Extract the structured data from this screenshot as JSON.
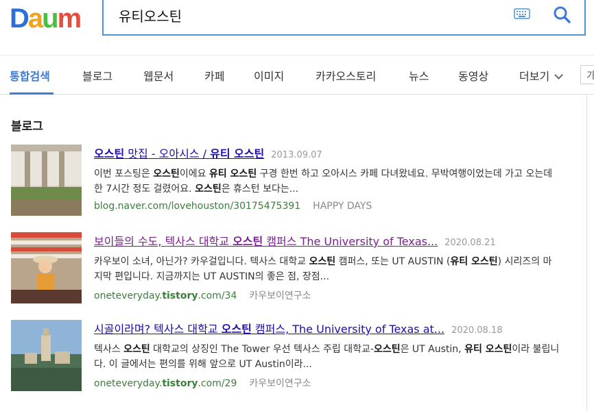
{
  "brand": {
    "logo_text": "Daum"
  },
  "search": {
    "query": "유티오스틴"
  },
  "tabs": [
    {
      "label": "통합검색",
      "active": true
    },
    {
      "label": "블로그"
    },
    {
      "label": "웹문서"
    },
    {
      "label": "카페"
    },
    {
      "label": "이미지"
    },
    {
      "label": "카카오스토리"
    },
    {
      "label": "뉴스"
    },
    {
      "label": "동영상"
    },
    {
      "label": "더보기"
    }
  ],
  "side_box_label": "가",
  "section": {
    "title": "블로그"
  },
  "results": [
    {
      "title_parts": [
        [
          "오스틴",
          true
        ],
        [
          " 맛집 - 오아시스 / ",
          false
        ],
        [
          "유티 오스틴",
          true
        ]
      ],
      "date": "2013.09.07",
      "desc_parts": [
        [
          "이번 포스팅은 ",
          false
        ],
        [
          "오스틴",
          true
        ],
        [
          "이에요 ",
          false
        ],
        [
          "유티 오스틴",
          true
        ],
        [
          " 구경 한번 하고 오아시스 카페 다녀왔네요. 무박여행이었는데 가고 오는데 한 7시간 정도 걸렸어요. ",
          false
        ],
        [
          "오스틴",
          true
        ],
        [
          "은 휴스턴 보다는...",
          false
        ]
      ],
      "url_parts": [
        [
          "blog.naver.com",
          false
        ],
        [
          "/lovehouston/30175475391",
          false
        ]
      ],
      "author": "HAPPY DAYS",
      "visited": false
    },
    {
      "title_parts": [
        [
          "보이들의 수도, 텍사스 대학교 ",
          false
        ],
        [
          "오스틴",
          true
        ],
        [
          " 캠퍼스 The University of Texas...",
          false
        ]
      ],
      "date": "2020.08.21",
      "desc_parts": [
        [
          "카우보이 소녀, 아닌가? 카우걸입니다. 텍사스 대학교 ",
          false
        ],
        [
          "오스틴",
          true
        ],
        [
          " 캠퍼스, 또는 UT AUSTIN (",
          false
        ],
        [
          "유티 오스틴",
          true
        ],
        [
          ") 시리즈의 마지막 편입니다. 지금까지는 UT AUSTIN의 좋은 점, 장점...",
          false
        ]
      ],
      "url_parts": [
        [
          "oneteveryday.",
          false
        ],
        [
          "tistory",
          true
        ],
        [
          ".com/34",
          false
        ]
      ],
      "author": "카우보이연구소",
      "visited": true
    },
    {
      "title_parts": [
        [
          "시골이라며? 텍사스 대학교 ",
          false
        ],
        [
          "오스틴",
          true
        ],
        [
          " 캠퍼스, The University of Texas at...",
          false
        ]
      ],
      "date": "2020.08.18",
      "desc_parts": [
        [
          "텍사스 ",
          false
        ],
        [
          "오스틴",
          true
        ],
        [
          " 대학교의 상징인 The Tower 우선 텍사스 주립 대학교-",
          false
        ],
        [
          "오스틴",
          true
        ],
        [
          "은 UT Austin, ",
          false
        ],
        [
          "유티 오스틴",
          true
        ],
        [
          "이라 불립니다. 이 글에서는 편의를 위해 앞으로 UT Austin이라...",
          false
        ]
      ],
      "url_parts": [
        [
          "oneteveryday.",
          false
        ],
        [
          "tistory",
          true
        ],
        [
          ".com/29",
          false
        ]
      ],
      "author": "카우보이연구소",
      "visited": false
    }
  ],
  "icons": {
    "search": "search-icon",
    "keyboard": "keyboard-icon",
    "more": "chevron-down-icon"
  },
  "colors": {
    "accent": "#3a7ad9",
    "link": "#1a0dab",
    "visited": "#7a1f8e",
    "url": "#3b7d3b"
  }
}
